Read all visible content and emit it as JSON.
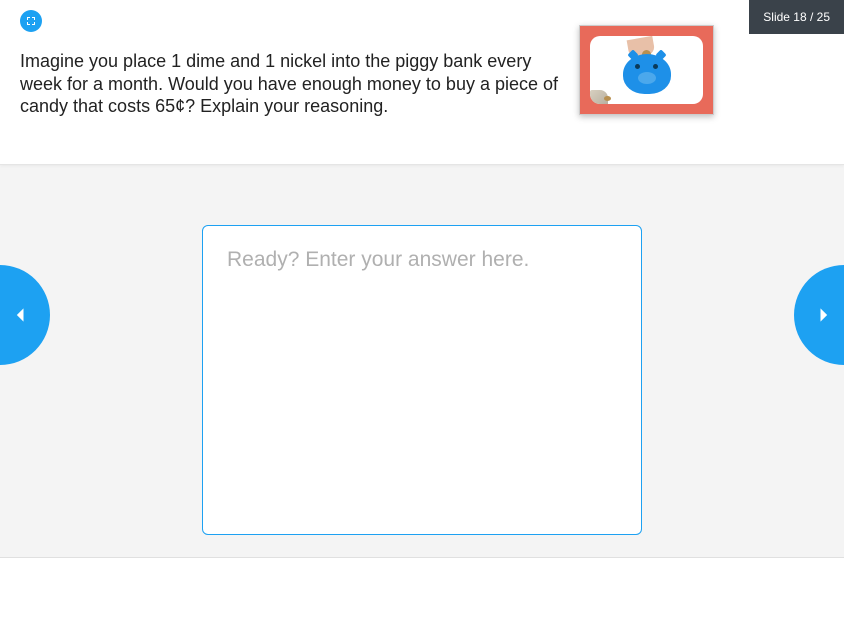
{
  "slide_counter": "Slide 18 / 25",
  "question": {
    "text": "Imagine you place 1 dime and 1 nickel into the piggy bank every week for a month. Would you have enough money to buy a piece of candy that costs 65¢? Explain your reasoning.",
    "image_alt": "piggy-bank-image"
  },
  "answer": {
    "placeholder": "Ready? Enter your answer here.",
    "value": ""
  },
  "colors": {
    "accent": "#1da1f2",
    "counter_bg": "#3a424a"
  }
}
